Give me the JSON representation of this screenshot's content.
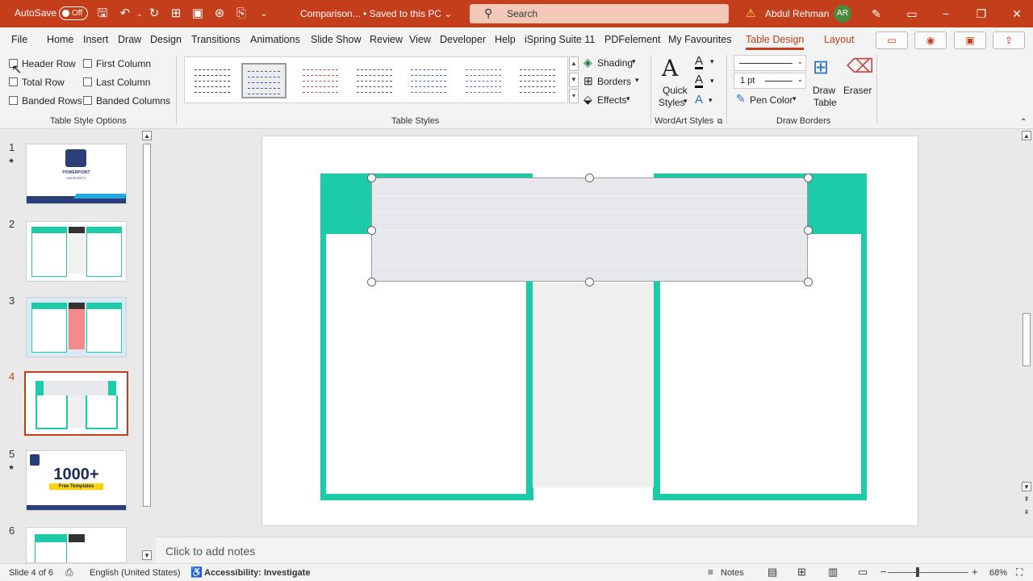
{
  "titlebar": {
    "autosave_label": "AutoSave",
    "autosave_state": "Off",
    "doc_title": "Comparison... • Saved to this PC ⌄",
    "search_placeholder": "Search",
    "user_name": "Abdul Rehman",
    "user_initials": "AR"
  },
  "menu": {
    "tabs": [
      "File",
      "Home",
      "Insert",
      "Draw",
      "Design",
      "Transitions",
      "Animations",
      "Slide Show",
      "Review",
      "View",
      "Developer",
      "Help",
      "iSpring Suite 11",
      "PDFelement",
      "My Favourites"
    ],
    "context_tabs": [
      "Table Design",
      "Layout"
    ],
    "active_tab": "Table Design"
  },
  "ribbon": {
    "table_style_options": {
      "label": "Table Style Options",
      "options": [
        "Header Row",
        "First Column",
        "Total Row",
        "Last Column",
        "Banded Rows",
        "Banded Columns"
      ]
    },
    "table_styles": {
      "label": "Table Styles",
      "colors": [
        "#444444",
        "#3b5f9a",
        "#c0504d",
        "#555555",
        "#4a6fa5",
        "#8064a2",
        "#555555"
      ],
      "shading": "Shading",
      "borders": "Borders",
      "effects": "Effects"
    },
    "wordart": {
      "label": "WordArt Styles",
      "quick_styles_1": "Quick",
      "quick_styles_2": "Styles"
    },
    "draw_borders": {
      "label": "Draw Borders",
      "pen_weight": "1 pt",
      "pen_color": "Pen Color",
      "draw_table_1": "Draw",
      "draw_table_2": "Table",
      "eraser": "Eraser"
    }
  },
  "thumbnails": {
    "slides": [
      {
        "num": "1",
        "starred": true,
        "logo_text": "POWERPOINT",
        "logo_sub": "UNIVERSITY"
      },
      {
        "num": "2",
        "starred": false
      },
      {
        "num": "3",
        "starred": false
      },
      {
        "num": "4",
        "starred": false,
        "selected": true
      },
      {
        "num": "5",
        "starred": true,
        "big_text": "1000+",
        "banner_text": "Free Templates"
      },
      {
        "num": "6",
        "starred": false
      }
    ]
  },
  "slide_colors": {
    "accent": "#1ecba9",
    "table_fill": "#e6e8ec",
    "center_panel": "#efefef"
  },
  "notes": {
    "placeholder": "Click to add notes"
  },
  "statusbar": {
    "slide_info": "Slide 4 of 6",
    "language": "English (United States)",
    "accessibility": "Accessibility: Investigate",
    "notes": "Notes",
    "zoom_minus": "−",
    "zoom_plus": "+",
    "zoom": "68%"
  }
}
